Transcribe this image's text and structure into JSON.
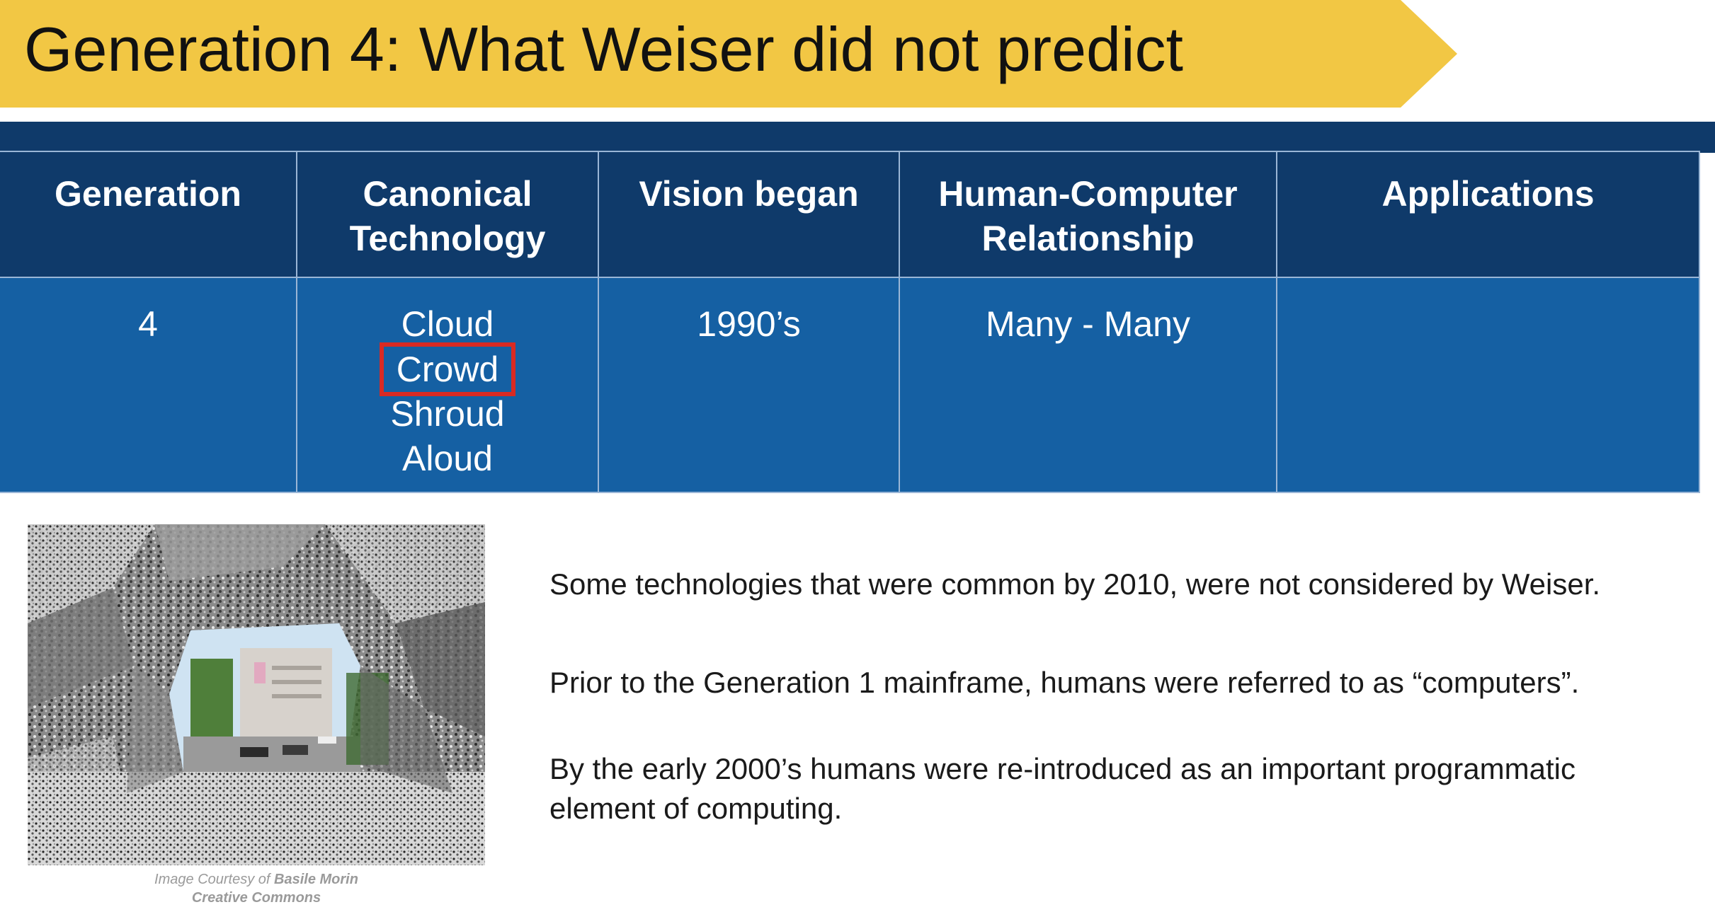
{
  "slide": {
    "title": "Generation 4: What Weiser did not predict",
    "accent_color": "#f2c744",
    "header_color": "#0f3a6a",
    "row_color": "#1560a3",
    "highlight_color": "#d92a23"
  },
  "table": {
    "headers": [
      "Generation",
      "Canonical Technology",
      "Vision began",
      "Human-Computer Relationship",
      "Applications"
    ],
    "rows": [
      {
        "generation": "4",
        "technologies": [
          "Cloud",
          "Crowd",
          "Shroud",
          "Aloud"
        ],
        "highlighted_technology": "Crowd",
        "vision_began": "1990’s",
        "relationship": "Many - Many",
        "applications": ""
      }
    ]
  },
  "image": {
    "alt_icon": "kaleidoscope-crowd-photo",
    "credit_prefix": "Image Courtesy of ",
    "credit_author": "Basile Morin",
    "credit_license": "Creative Commons"
  },
  "body": {
    "paragraphs": [
      "Some technologies  that were common by 2010, were not considered by Weiser.",
      "Prior to the Generation  1 mainframe, humans were referred to as “computers”.",
      "By the early 2000’s humans were re-introduced as an important programmatic element of computing."
    ]
  }
}
